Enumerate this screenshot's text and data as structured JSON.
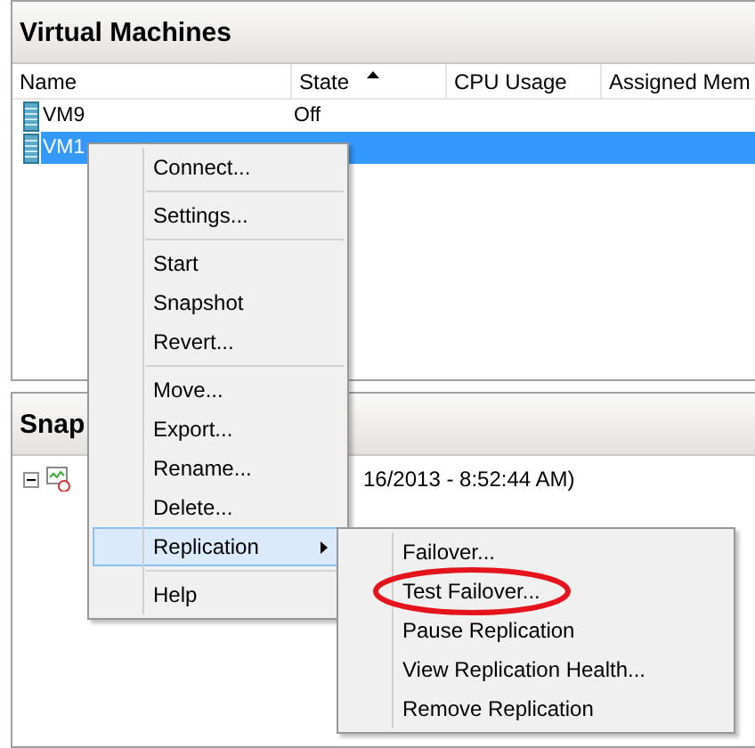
{
  "vm_panel": {
    "title": "Virtual Machines",
    "columns": [
      {
        "label": "Name",
        "sorted": false
      },
      {
        "label": "State",
        "sorted": true
      },
      {
        "label": "CPU Usage",
        "sorted": false
      },
      {
        "label": "Assigned Mem",
        "sorted": false
      }
    ],
    "rows": [
      {
        "name": "VM9",
        "state": "Off",
        "selected": false
      },
      {
        "name": "VM1",
        "selected": true
      }
    ]
  },
  "snapshot_panel": {
    "title": "Snap",
    "tree": [
      {
        "label": "16/2013 - 8:52:44 AM)",
        "expanded": true
      }
    ]
  },
  "context_menu": {
    "groups": [
      [
        {
          "label": "Connect...",
          "selected": false,
          "submenu": false
        }
      ],
      [
        {
          "label": "Settings...",
          "selected": false,
          "submenu": false
        }
      ],
      [
        {
          "label": "Start",
          "selected": false,
          "submenu": false
        },
        {
          "label": "Snapshot",
          "selected": false,
          "submenu": false
        },
        {
          "label": "Revert...",
          "selected": false,
          "submenu": false
        }
      ],
      [
        {
          "label": "Move...",
          "selected": false,
          "submenu": false
        },
        {
          "label": "Export...",
          "selected": false,
          "submenu": false
        },
        {
          "label": "Rename...",
          "selected": false,
          "submenu": false
        },
        {
          "label": "Delete...",
          "selected": false,
          "submenu": false
        },
        {
          "label": "Replication",
          "selected": true,
          "submenu": true
        }
      ],
      [
        {
          "label": "Help",
          "selected": false,
          "submenu": false
        }
      ]
    ]
  },
  "submenu": {
    "items": [
      {
        "label": "Failover...",
        "highlighted": false
      },
      {
        "label": "Test Failover...",
        "highlighted": true
      },
      {
        "label": "Pause Replication",
        "highlighted": false
      },
      {
        "label": "View Replication Health...",
        "highlighted": false
      },
      {
        "label": "Remove Replication",
        "highlighted": false
      }
    ]
  }
}
